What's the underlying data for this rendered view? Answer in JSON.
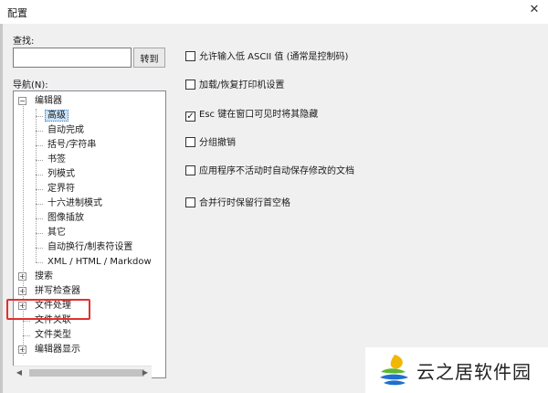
{
  "window": {
    "title": "配置",
    "close_glyph": "✕"
  },
  "search": {
    "label": "查找:",
    "value": "",
    "goto_label": "转到"
  },
  "nav": {
    "label": "导航(N):",
    "tree": [
      {
        "label": "编辑器",
        "expander": "−"
      },
      {
        "label": "高级"
      },
      {
        "label": "自动完成"
      },
      {
        "label": "括号/字符串"
      },
      {
        "label": "书签"
      },
      {
        "label": "列模式"
      },
      {
        "label": "定界符"
      },
      {
        "label": "十六进制模式"
      },
      {
        "label": "图像插放"
      },
      {
        "label": "其它"
      },
      {
        "label": "自动换行/制表符设置"
      },
      {
        "label": "XML / HTML / Markdow"
      },
      {
        "label": "搜索",
        "expander": "+"
      },
      {
        "label": "拼写检查器",
        "expander": "+"
      },
      {
        "label": "文件处理",
        "expander": "+"
      },
      {
        "label": "文件关联"
      },
      {
        "label": "文件类型"
      },
      {
        "label": "编辑器显示",
        "expander": "+"
      }
    ],
    "selected_index": 1,
    "scroll_up_glyph": "▲",
    "scroll_down_glyph": "▼",
    "scroll_left_glyph": "◀",
    "scroll_right_glyph": "▶"
  },
  "options": [
    {
      "label": "允许输入低 ASCII 值 (通常是控制码)",
      "checked": false
    },
    {
      "label": "加载/恢复打印机设置",
      "checked": false
    },
    {
      "label": "Esc 键在窗口可见时将其隐藏",
      "checked": true
    },
    {
      "label": "分组撤销",
      "checked": false
    },
    {
      "label": "应用程序不活动时自动保存修改的文档",
      "checked": false
    },
    {
      "label": "合并行时保留行首空格",
      "checked": false
    }
  ],
  "check_glyph": "✓",
  "watermark": {
    "text": "云之居软件园"
  },
  "colors": {
    "highlight": "#e03030",
    "selection": "#cce4f7",
    "logo_blue": "#1f6fd0",
    "logo_green": "#5cb82e",
    "logo_yellow": "#f2b705"
  }
}
